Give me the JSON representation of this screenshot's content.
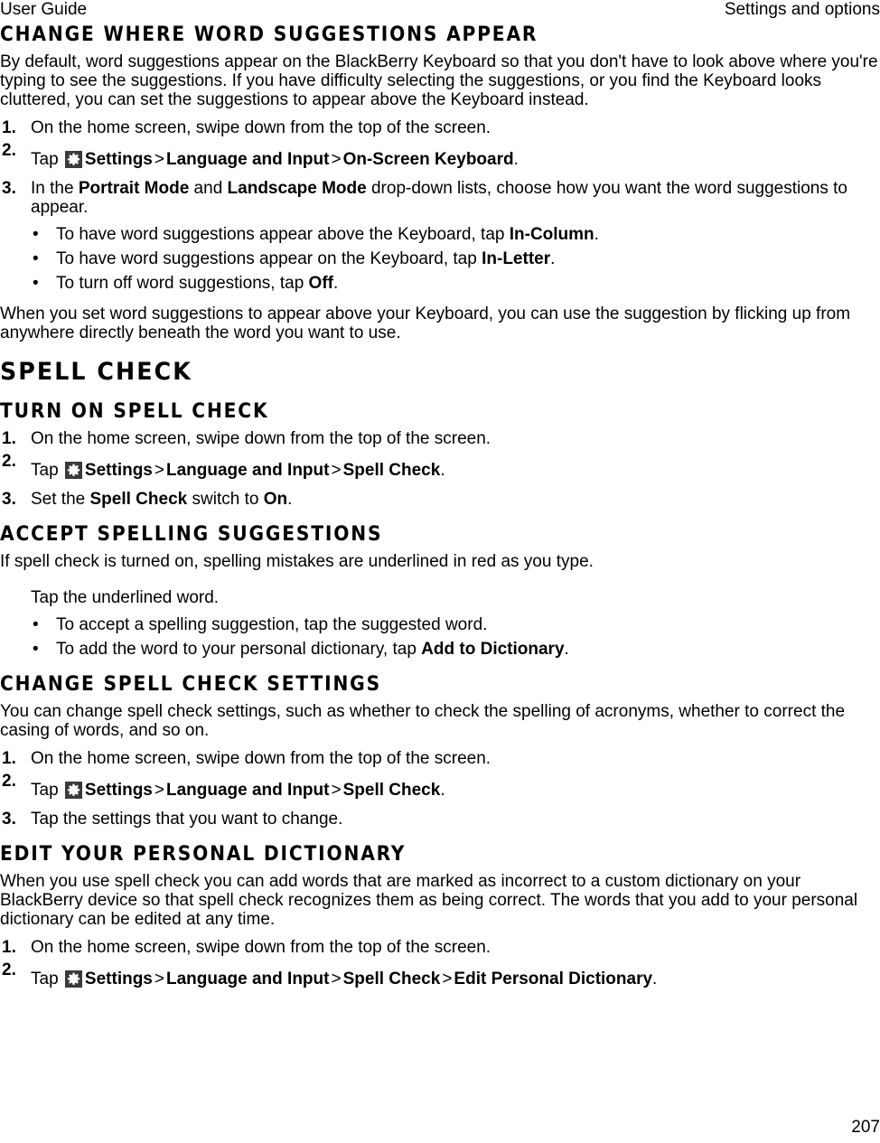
{
  "header": {
    "left": "User Guide",
    "right": "Settings and options"
  },
  "icons": {
    "settings_gear": "gear-icon"
  },
  "sections": [
    {
      "id": "change-where-word-suggestions-appear",
      "level": 2,
      "heading": "Change where word suggestions appear",
      "intro": "By default, word suggestions appear on the BlackBerry Keyboard so that you don't have to look above where you're typing to see the suggestions. If you have difficulty selecting the suggestions, or you find the Keyboard looks cluttered, you can set the suggestions to appear above the Keyboard instead.",
      "steps": [
        {
          "num": "1.",
          "text": "On the home screen, swipe down from the top of the screen."
        },
        {
          "num": "2.",
          "icon": true,
          "pre": "Tap",
          "crumbs": [
            "Settings",
            "Language and Input",
            "On-Screen Keyboard"
          ],
          "post": "."
        },
        {
          "num": "3.",
          "rich": true,
          "parts": [
            {
              "t": "In the ",
              "b": false
            },
            {
              "t": "Portrait Mode",
              "b": true
            },
            {
              "t": " and ",
              "b": false
            },
            {
              "t": "Landscape Mode",
              "b": true
            },
            {
              "t": " drop-down lists, choose how you want the word suggestions to appear.",
              "b": false
            }
          ]
        }
      ],
      "bullets": [
        [
          {
            "t": "To have word suggestions appear above the Keyboard, tap ",
            "b": false
          },
          {
            "t": "In-Column",
            "b": true
          },
          {
            "t": ".",
            "b": false
          }
        ],
        [
          {
            "t": "To have word suggestions appear on the Keyboard, tap ",
            "b": false
          },
          {
            "t": "In-Letter",
            "b": true
          },
          {
            "t": ".",
            "b": false
          }
        ],
        [
          {
            "t": "To turn off word suggestions, tap ",
            "b": false
          },
          {
            "t": "Off",
            "b": true
          },
          {
            "t": ".",
            "b": false
          }
        ]
      ],
      "outro": "When you set word suggestions to appear above your Keyboard, you can use the suggestion by flicking up from anywhere directly beneath the word you want to use."
    },
    {
      "id": "spell-check",
      "level": 1,
      "heading": "Spell check"
    },
    {
      "id": "turn-on-spell-check",
      "level": 2,
      "heading": "Turn on spell check",
      "steps": [
        {
          "num": "1.",
          "text": "On the home screen, swipe down from the top of the screen."
        },
        {
          "num": "2.",
          "icon": true,
          "pre": "Tap",
          "crumbs": [
            "Settings",
            "Language and Input",
            "Spell Check"
          ],
          "post": "."
        },
        {
          "num": "3.",
          "rich": true,
          "parts": [
            {
              "t": "Set the ",
              "b": false
            },
            {
              "t": "Spell Check",
              "b": true
            },
            {
              "t": " switch to ",
              "b": false
            },
            {
              "t": "On",
              "b": true
            },
            {
              "t": ".",
              "b": false
            }
          ]
        }
      ]
    },
    {
      "id": "accept-spelling-suggestions",
      "level": 2,
      "heading": "Accept spelling suggestions",
      "intro": "If spell check is turned on, spelling mistakes are underlined in red as you type.",
      "substep": "Tap the underlined word.",
      "bullets": [
        [
          {
            "t": "To accept a spelling suggestion, tap the suggested word.",
            "b": false
          }
        ],
        [
          {
            "t": "To add the word to your personal dictionary, tap ",
            "b": false
          },
          {
            "t": "Add to Dictionary",
            "b": true
          },
          {
            "t": ".",
            "b": false
          }
        ]
      ]
    },
    {
      "id": "change-spell-check-settings",
      "level": 2,
      "heading": "Change spell check settings",
      "intro": "You can change spell check settings, such as whether to check the spelling of acronyms, whether to correct the casing of words, and so on.",
      "steps": [
        {
          "num": "1.",
          "text": "On the home screen, swipe down from the top of the screen."
        },
        {
          "num": "2.",
          "icon": true,
          "pre": "Tap",
          "crumbs": [
            "Settings",
            "Language and Input",
            "Spell Check"
          ],
          "post": "."
        },
        {
          "num": "3.",
          "text": "Tap the settings that you want to change."
        }
      ]
    },
    {
      "id": "edit-your-personal-dictionary",
      "level": 2,
      "heading": "Edit your personal dictionary",
      "intro": "When you use spell check you can add words that are marked as incorrect to a custom dictionary on your BlackBerry device so that spell check recognizes them as being correct. The words that you add to your personal dictionary can be edited at any time.",
      "steps": [
        {
          "num": "1.",
          "text": "On the home screen, swipe down from the top of the screen."
        },
        {
          "num": "2.",
          "icon": true,
          "pre": "Tap",
          "crumbs": [
            "Settings",
            "Language and Input",
            "Spell Check",
            "Edit Personal Dictionary"
          ],
          "post": "."
        }
      ]
    }
  ],
  "footer": {
    "page_number": "207"
  }
}
